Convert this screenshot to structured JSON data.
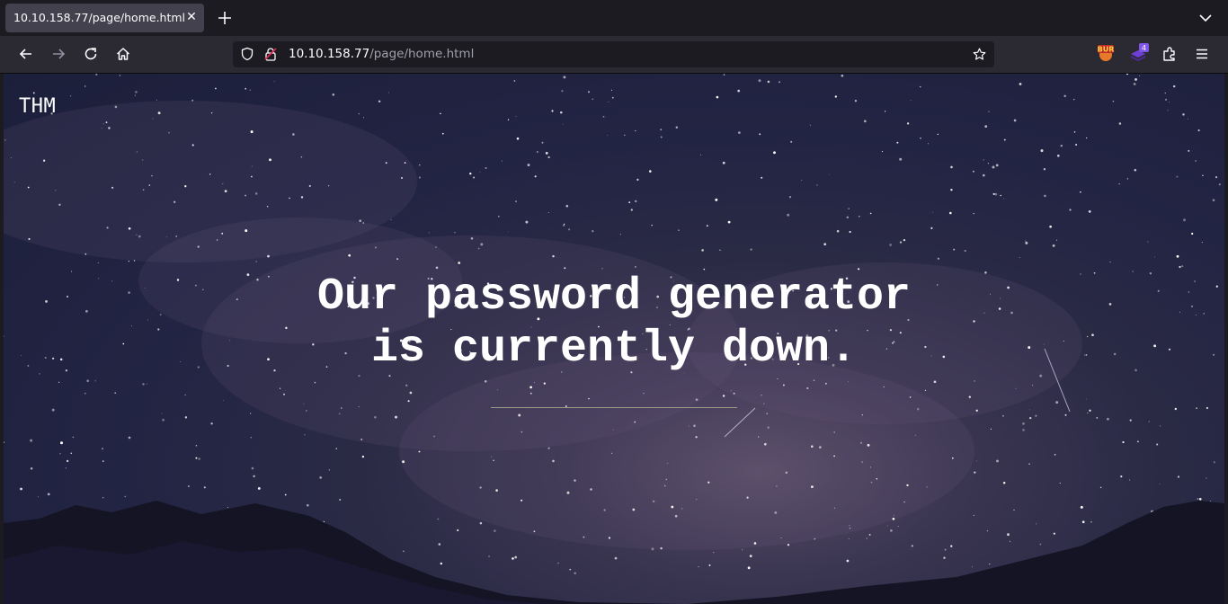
{
  "browser": {
    "tab": {
      "title": "10.10.158.77/page/home.html",
      "close_glyph": "✕"
    },
    "toolbar": {
      "url_host": "10.10.158.77",
      "url_path": "/page/home.html",
      "icons": [
        "back-arrow-icon",
        "forward-arrow-icon",
        "reload-icon",
        "home-icon",
        "shield-icon",
        "lock-icon",
        "bookmark-star-icon",
        "extensions-puzzle-icon",
        "menu-hamburger-icon"
      ],
      "extensions": {
        "burp": {
          "label": "BUR"
        },
        "foxyproxy": {
          "badge": "4"
        }
      }
    }
  },
  "page": {
    "brand": "THM",
    "headline_line1": "Our password generator",
    "headline_line2": "is currently down."
  },
  "colors": {
    "chrome_dark": "#1c1b22",
    "toolbar": "#2b2a33",
    "tab_active": "#42414d",
    "sky": "#222443",
    "text": "#ffffff"
  }
}
